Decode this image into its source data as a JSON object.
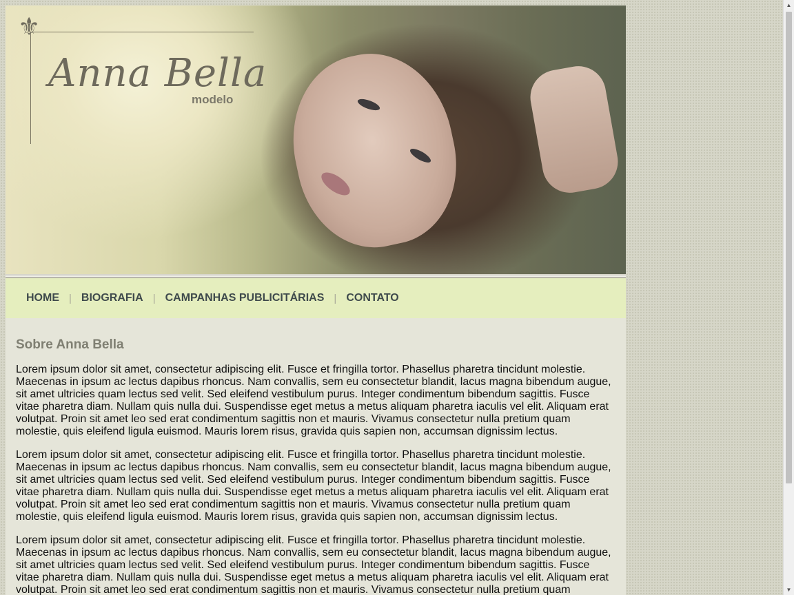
{
  "header": {
    "logo_title": "Anna Bella",
    "logo_subtitle": "modelo",
    "ornament_icon": "fleur-de-lis-icon"
  },
  "nav": {
    "items": [
      {
        "label": "HOME"
      },
      {
        "label": "BIOGRAFIA"
      },
      {
        "label": "CAMPANHAS PUBLICITÁRIAS"
      },
      {
        "label": "CONTATO"
      }
    ],
    "separator": "|"
  },
  "content": {
    "title": "Sobre Anna Bella",
    "paragraphs": [
      "Lorem ipsum dolor sit amet, consectetur adipiscing elit. Fusce et fringilla tortor. Phasellus pharetra tincidunt molestie. Maecenas in ipsum ac lectus dapibus rhoncus. Nam convallis, sem eu consectetur blandit, lacus magna bibendum augue, sit amet ultricies quam lectus sed velit. Sed eleifend vestibulum purus. Integer condimentum bibendum sagittis. Fusce vitae pharetra diam. Nullam quis nulla dui. Suspendisse eget metus a metus aliquam pharetra iaculis vel elit. Aliquam erat volutpat. Proin sit amet leo sed erat condimentum sagittis non et mauris. Vivamus consectetur nulla pretium quam molestie, quis eleifend ligula euismod. Mauris lorem risus, gravida quis sapien non, accumsan dignissim lectus.",
      "Lorem ipsum dolor sit amet, consectetur adipiscing elit. Fusce et fringilla tortor. Phasellus pharetra tincidunt molestie. Maecenas in ipsum ac lectus dapibus rhoncus. Nam convallis, sem eu consectetur blandit, lacus magna bibendum augue, sit amet ultricies quam lectus sed velit. Sed eleifend vestibulum purus. Integer condimentum bibendum sagittis. Fusce vitae pharetra diam. Nullam quis nulla dui. Suspendisse eget metus a metus aliquam pharetra iaculis vel elit. Aliquam erat volutpat. Proin sit amet leo sed erat condimentum sagittis non et mauris. Vivamus consectetur nulla pretium quam molestie, quis eleifend ligula euismod. Mauris lorem risus, gravida quis sapien non, accumsan dignissim lectus.",
      "Lorem ipsum dolor sit amet, consectetur adipiscing elit. Fusce et fringilla tortor. Phasellus pharetra tincidunt molestie. Maecenas in ipsum ac lectus dapibus rhoncus. Nam convallis, sem eu consectetur blandit, lacus magna bibendum augue, sit amet ultricies quam lectus sed velit. Sed eleifend vestibulum purus. Integer condimentum bibendum sagittis. Fusce vitae pharetra diam. Nullam quis nulla dui. Suspendisse eget metus a metus aliquam pharetra iaculis vel elit. Aliquam erat volutpat. Proin sit amet leo sed erat condimentum sagittis non et mauris. Vivamus consectetur nulla pretium quam molestie, quis eleifend ligula euismod. Mauris lorem risus, gravida quis sapien non, accumsan dignissim lectus."
    ]
  },
  "colors": {
    "nav_background": "#e5eebe",
    "content_background": "#e5e5d9",
    "nav_text": "#3f4a4c",
    "heading_text": "#7f7f72"
  },
  "scrollbar": {
    "up_icon": "scroll-up-arrow-icon",
    "down_icon": "scroll-down-arrow-icon"
  }
}
